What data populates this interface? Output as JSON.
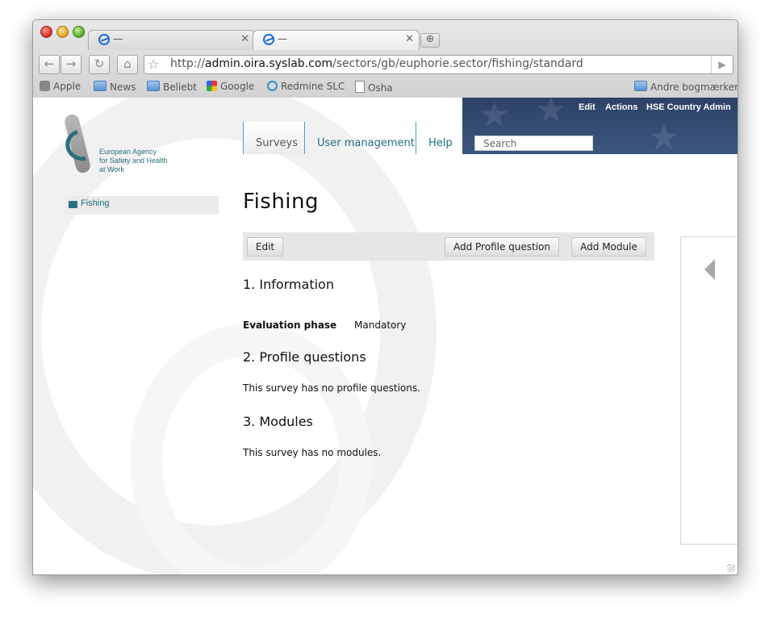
{
  "browser": {
    "tabs": [
      {
        "title": "—",
        "active": false
      },
      {
        "title": "—",
        "active": true
      }
    ],
    "url_prefix": "http://",
    "url_domain": "admin.oira.syslab.com",
    "url_path": "/sectors/gb/euphorie.sector/fishing/standard",
    "nav_icons": {
      "back": "back-arrow-icon",
      "forward": "forward-arrow-icon",
      "reload": "reload-icon",
      "home": "home-icon"
    },
    "bookmarks": {
      "apple": "Apple",
      "news": "News",
      "beliebt": "Beliebt",
      "google": "Google",
      "redmine": "Redmine SLC",
      "osha": "Osha",
      "other": "Andre bogmærker"
    }
  },
  "site": {
    "logo_text": "European Agency\nfor Safety and Health\nat Work",
    "header_links": {
      "edit": "Edit",
      "actions": "Actions",
      "user": "HSE Country Admin"
    },
    "search_placeholder": "Search",
    "nav": {
      "surveys": "Surveys",
      "user_management": "User management",
      "help": "Help"
    },
    "sidebar_item": "Fishing",
    "colors": {
      "banner": "#2d4166",
      "link": "#1f6d86",
      "accent": "#2a6f7c"
    }
  },
  "main": {
    "title": "Fishing",
    "buttons": {
      "edit": "Edit",
      "add_profile_question": "Add Profile question",
      "add_module": "Add Module"
    },
    "sections": {
      "information": "1. Information",
      "evaluation_label": "Evaluation phase",
      "evaluation_value": "Mandatory",
      "profile_questions": "2. Profile questions",
      "profile_empty": "This survey has no profile questions.",
      "modules": "3. Modules",
      "modules_empty": "This survey has no modules."
    }
  }
}
